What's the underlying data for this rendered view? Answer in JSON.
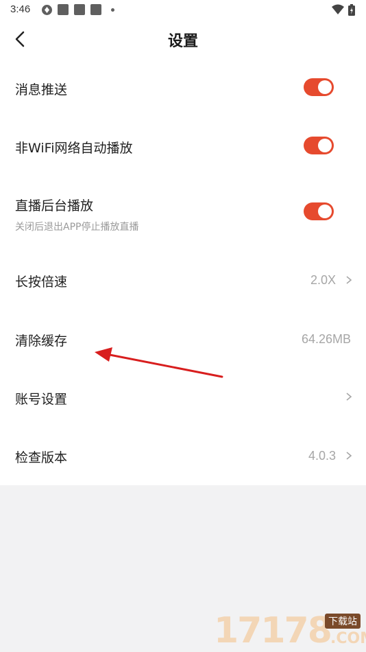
{
  "status_bar": {
    "time": "3:46"
  },
  "header": {
    "title": "设置"
  },
  "settings": {
    "push": {
      "label": "消息推送",
      "enabled": true
    },
    "wifi_autoplay": {
      "label": "非WiFi网络自动播放",
      "enabled": true
    },
    "background_play": {
      "label": "直播后台播放",
      "sublabel": "关闭后退出APP停止播放直播",
      "enabled": true
    },
    "long_press_speed": {
      "label": "长按倍速",
      "value": "2.0X"
    },
    "clear_cache": {
      "label": "清除缓存",
      "value": "64.26MB"
    },
    "account": {
      "label": "账号设置"
    },
    "check_version": {
      "label": "检查版本",
      "value": "4.0.3"
    }
  },
  "colors": {
    "toggle_on": "#e64a2e",
    "annotation_arrow": "#d81e1e"
  },
  "watermark": {
    "digits": "17178",
    "badge": "下载站",
    "domain": ".COM"
  }
}
